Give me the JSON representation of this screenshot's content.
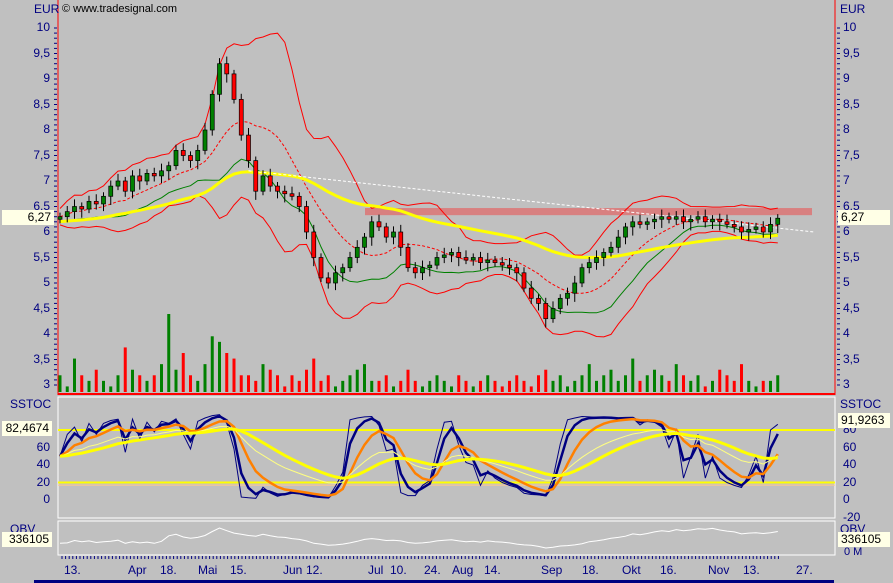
{
  "header": {
    "currency_left": "EUR",
    "currency_right": "EUR",
    "watermark": "© www.tradesignal.com"
  },
  "price_panel": {
    "last_value_left": "6,27",
    "last_value_right": "6,27",
    "tick_labels": [
      "10",
      "9,5",
      "9",
      "8,5",
      "8",
      "7,5",
      "7",
      "6,5",
      "6",
      "5,5",
      "5",
      "4,5",
      "4",
      "3,5",
      "3"
    ]
  },
  "sstoc_panel": {
    "title_left": "SSTOC",
    "title_right": "SSTOC",
    "value_left": "82,4674",
    "value_right": "91,9263",
    "tick_labels": [
      "80",
      "60",
      "40",
      "20",
      "0",
      "-20"
    ]
  },
  "obv_panel": {
    "title_left": "OBV",
    "title_right": "OBV",
    "value_left": "336105",
    "value_right": "336105",
    "zero_label": "0 M"
  },
  "date_axis": {
    "labels": [
      "13.",
      "Apr",
      "18.",
      "Mai",
      "15.",
      "Jun",
      "12.",
      "Jul",
      "10.",
      "24.",
      "Aug",
      "14.",
      "Sep",
      "18.",
      "Okt",
      "16.",
      "Nov",
      "13.",
      "27."
    ]
  },
  "colors": {
    "up": "#008000",
    "down": "#ff0000",
    "band": "#ff0000",
    "mid": "#008000",
    "ma": "#ffff00",
    "fast": "#000080",
    "slow": "#ff8000",
    "resistance": "#d88080"
  },
  "chart_data": {
    "type": "candlestick",
    "ylabel": "EUR",
    "ylim": [
      3,
      10
    ],
    "closes": [
      6.3,
      6.4,
      6.5,
      6.45,
      6.6,
      6.55,
      6.7,
      6.9,
      7.0,
      6.8,
      7.1,
      7.0,
      7.15,
      7.1,
      7.2,
      7.3,
      7.6,
      7.5,
      7.4,
      7.6,
      8.0,
      8.7,
      9.3,
      9.1,
      8.6,
      7.9,
      7.4,
      6.8,
      7.1,
      6.9,
      6.8,
      6.75,
      6.7,
      6.5,
      6.0,
      5.5,
      5.1,
      5.0,
      5.2,
      5.3,
      5.5,
      5.7,
      5.9,
      6.2,
      6.1,
      5.9,
      6.0,
      5.7,
      5.3,
      5.2,
      5.3,
      5.35,
      5.5,
      5.55,
      5.6,
      5.5,
      5.45,
      5.5,
      5.4,
      5.45,
      5.4,
      5.35,
      5.3,
      5.2,
      4.9,
      4.7,
      4.6,
      4.3,
      4.5,
      4.7,
      4.8,
      5.0,
      5.3,
      5.4,
      5.5,
      5.6,
      5.7,
      5.9,
      6.1,
      6.2,
      6.15,
      6.2,
      6.25,
      6.3,
      6.25,
      6.3,
      6.2,
      6.25,
      6.3,
      6.2,
      6.25,
      6.2,
      6.15,
      6.1,
      6.0,
      6.05,
      6.1,
      6.0,
      6.15,
      6.27
    ],
    "volumes": [
      3,
      1,
      6,
      3,
      2,
      4,
      2,
      1,
      3,
      8,
      4,
      3,
      2,
      3,
      5,
      14,
      4,
      7,
      3,
      2,
      5,
      10,
      9,
      7,
      6,
      3,
      3,
      2,
      5,
      4,
      3,
      1,
      3,
      2,
      4,
      6,
      2,
      3,
      1,
      2,
      3,
      4,
      5,
      2,
      2,
      3,
      1,
      2,
      4,
      2,
      1,
      2,
      3,
      2,
      1,
      3,
      2,
      1,
      2,
      3,
      2,
      1,
      2,
      3,
      2,
      1,
      3,
      4,
      2,
      3,
      1,
      2,
      3,
      5,
      2,
      3,
      4,
      2,
      3,
      6,
      2,
      3,
      4,
      3,
      2,
      5,
      3,
      2,
      3,
      1,
      2,
      4,
      3,
      2,
      5,
      2,
      1,
      2,
      2,
      3
    ],
    "resistance_zone": [
      6.33,
      6.47
    ],
    "trendline": [
      [
        26,
        7.2
      ],
      [
        104,
        6.0
      ]
    ],
    "sstoc_levels": [
      80,
      20,
      17
    ],
    "current": 6.27
  }
}
